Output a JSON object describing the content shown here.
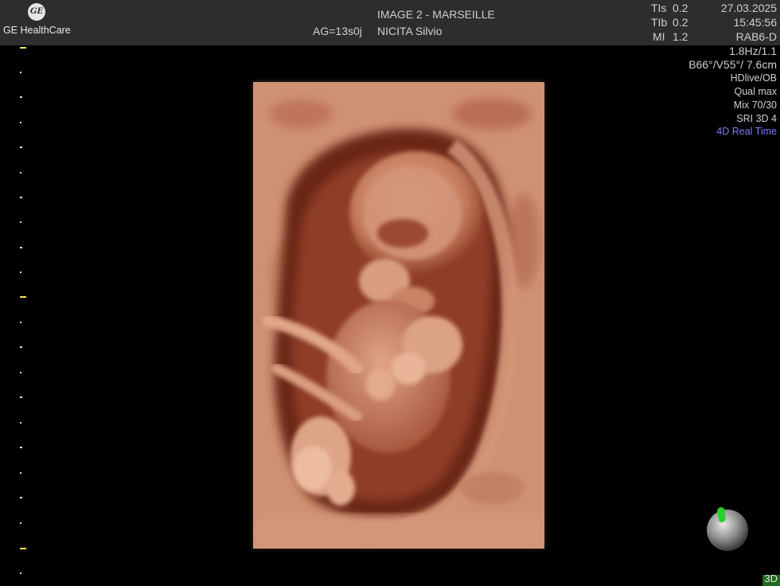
{
  "header": {
    "logo_mark": "GE",
    "logo_text": "GE HealthCare",
    "image_title": "IMAGE 2 - MARSEILLE",
    "gestational_age": "AG=13s0j",
    "patient_name": "NICITA Silvio"
  },
  "readouts": {
    "tis_label": "TIs",
    "tis_value": "0.2",
    "tib_label": "TIb",
    "tib_value": "0.2",
    "mi_label": "MI",
    "mi_value": "1.2",
    "date": "27.03.2025",
    "time": "15:45:56",
    "probe": "RAB6-D"
  },
  "params": {
    "frame_rate": "1.8Hz/1.1",
    "geometry": "B66°/V55°/ 7.6cm",
    "preset": "HDlive/OB",
    "quality": "Qual max",
    "mix": "Mix 70/30",
    "sri": "SRI 3D 4",
    "mode_realtime": "4D Real Time"
  },
  "footer": {
    "mode": "3D"
  },
  "colors": {
    "header_bg": "#2d2d2d",
    "scale_major": "#f0e060",
    "realtime_text": "#7d7dff",
    "orientation_marker": "#2bcf2b",
    "skin_tone": "#c9876a"
  },
  "icons": {
    "orientation": "orientation-sphere-icon",
    "logo": "ge-monogram-icon"
  }
}
